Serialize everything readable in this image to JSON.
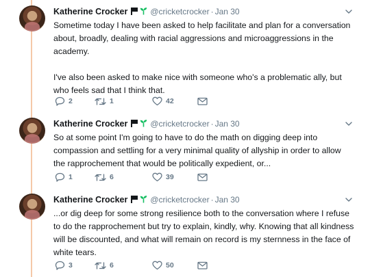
{
  "tweets": [
    {
      "author": {
        "name": "Katherine Crocker",
        "handle": "@cricketcrocker",
        "badges": [
          "flag-icon",
          "seedling-icon"
        ]
      },
      "separator": "·",
      "date": "Jan 30",
      "paragraphs": [
        "Sometime today I have been asked to help facilitate and plan for a conversation about, broadly, dealing with racial aggressions and microaggressions in the academy.",
        "I've also been asked to make nice with someone who's a problematic ally, but who feels sad that I think that."
      ],
      "actions": {
        "replies": "2",
        "retweets": "1",
        "likes": "42"
      }
    },
    {
      "author": {
        "name": "Katherine Crocker",
        "handle": "@cricketcrocker",
        "badges": [
          "flag-icon",
          "seedling-icon"
        ]
      },
      "separator": "·",
      "date": "Jan 30",
      "paragraphs": [
        "So at some point I'm going to have to do the math on digging deep into compassion and settling for a very minimal quality of allyship in order to allow the rapprochement that would be politically expedient, or..."
      ],
      "actions": {
        "replies": "1",
        "retweets": "6",
        "likes": "39"
      }
    },
    {
      "author": {
        "name": "Katherine Crocker",
        "handle": "@cricketcrocker",
        "badges": [
          "flag-icon",
          "seedling-icon"
        ]
      },
      "separator": "·",
      "date": "Jan 30",
      "paragraphs": [
        "...or dig deep for some strong resilience both to the conversation where I refuse to do the rapprochement but try to explain, kindly, why. Knowing that all kindness will be discounted, and what will remain on record is my sternness in the face of white tears."
      ],
      "actions": {
        "replies": "3",
        "retweets": "6",
        "likes": "50"
      }
    }
  ],
  "colors": {
    "text": "#14171a",
    "secondary": "#657786",
    "seedling": "#17bf63",
    "thread_line": "#f5c8a8"
  }
}
